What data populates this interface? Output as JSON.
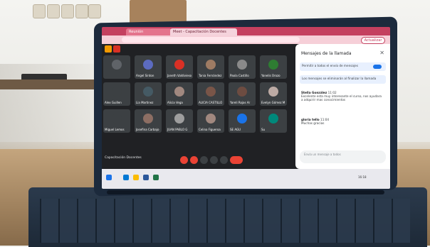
{
  "browser": {
    "tabs": [
      "Reunión",
      "Meet - Capacitación Docentes"
    ],
    "profile_button": "Actualizar"
  },
  "meeting": {
    "title": "Capacitación Docentes",
    "participants": [
      {
        "name": "",
        "color": "#5f6368"
      },
      {
        "name": "Angel Sirdon",
        "color": "#5c6bc0"
      },
      {
        "name": "Janeth Valdivieso",
        "color": "#d93025"
      },
      {
        "name": "Tania Fernández",
        "color": "#9e7b63"
      },
      {
        "name": "Paola Castillo",
        "color": "#8a8a8a"
      },
      {
        "name": "Yanelis Orozo",
        "color": "#2e7d32"
      },
      {
        "name": "Alex Guillen",
        "color": "#3c4043"
      },
      {
        "name": "Lia Martinez",
        "color": "#455a64"
      },
      {
        "name": "Alicia Vega",
        "color": "#a1887f"
      },
      {
        "name": "ALICIA CASTILLO",
        "color": "#795548"
      },
      {
        "name": "Yareli Rojas Ar",
        "color": "#6d4c41"
      },
      {
        "name": "Evelyn Gómez M",
        "color": "#bcaaa4"
      },
      {
        "name": "Miguel Lemos",
        "color": "#3c4043"
      },
      {
        "name": "Josefina Carbajo",
        "color": "#8d6e63"
      },
      {
        "name": "JUAN PABLO G",
        "color": "#9e9e9e"
      },
      {
        "name": "Celina Figueroa",
        "color": "#a1887f"
      },
      {
        "name": "SE AGU",
        "color": "#1a73e8"
      },
      {
        "name": "Su",
        "color": "#00897b"
      }
    ],
    "controls": [
      "mic",
      "camera",
      "raise-hand",
      "present",
      "more",
      "leave"
    ]
  },
  "chat": {
    "title": "Mensajes de la llamada",
    "toggle_label": "Permitir a todos el envío de mensajes",
    "notice": "Los mensajes se eliminarán al finalizar la llamada",
    "messages": [
      {
        "author": "Stella González",
        "time": "11:02",
        "text": "Excelente esta muy interesante el curso, nos ayudara a adquirir mas conocimientos"
      },
      {
        "author": "gloria tello",
        "time": "11:04",
        "text": "Muchas gracias"
      }
    ],
    "input_placeholder": "Envía un mensaje a todos"
  },
  "taskbar": {
    "items": [
      "buscar",
      "Edge",
      "Chrome",
      "Word",
      "Excel"
    ],
    "right": [
      "16:18"
    ]
  },
  "colors": {
    "accent": "#c4405f",
    "meet_bg": "#202124",
    "leave": "#ea4335",
    "toggle": "#1a73e8"
  }
}
